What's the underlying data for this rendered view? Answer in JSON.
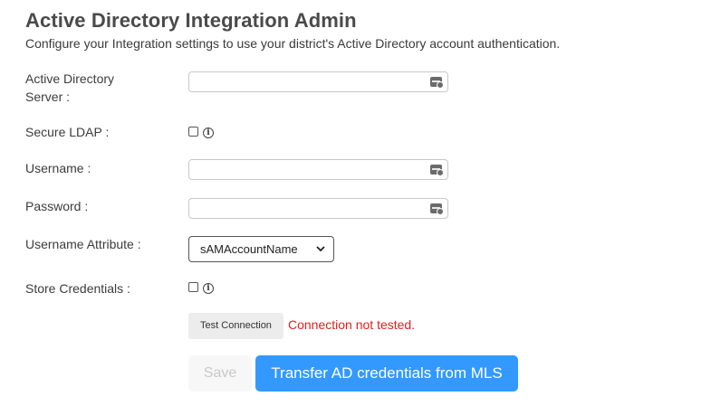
{
  "header": {
    "title": "Active Directory Integration Admin",
    "subtitle": "Configure your Integration settings to use your district's Active Directory account authentication."
  },
  "form": {
    "server": {
      "label_line1": "Active Directory",
      "label_line2": "Server :",
      "value": "",
      "icon": "key-icon"
    },
    "secure_ldap": {
      "label": "Secure LDAP :",
      "checked": false,
      "info_glyph": "i"
    },
    "username": {
      "label": "Username :",
      "value": "",
      "icon": "key-icon"
    },
    "password": {
      "label": "Password :",
      "value": "",
      "icon": "key-icon"
    },
    "username_attribute": {
      "label": "Username Attribute :",
      "selected": "sAMAccountName"
    },
    "store_credentials": {
      "label": "Store Credentials :",
      "checked": false,
      "info_glyph": "i"
    }
  },
  "actions": {
    "test_connection_label": "Test Connection",
    "connection_status": "Connection not tested.",
    "save_label": "Save",
    "transfer_label": "Transfer AD credentials from MLS"
  },
  "colors": {
    "status_error": "#e02020",
    "primary_button": "#3399ff",
    "disabled_text": "#c9c9c9"
  }
}
